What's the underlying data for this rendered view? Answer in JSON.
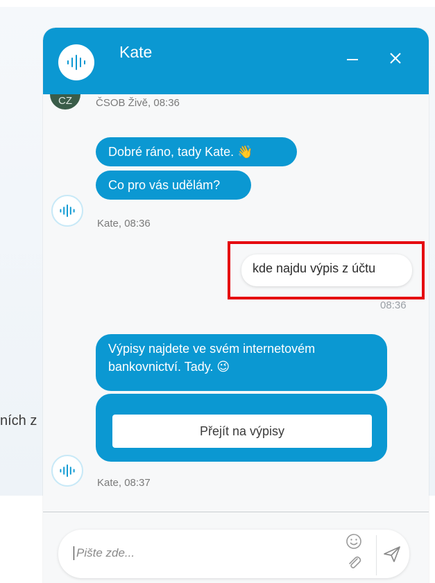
{
  "background": {
    "partial_text": "ních z"
  },
  "header": {
    "title": "Kate",
    "minimize_icon": "minimize-icon",
    "close_icon": "close-icon",
    "brand_color": "#0b98d2"
  },
  "messages": {
    "first_avatar_initials": "CZ",
    "first_meta": "ČSOB Živě, 08:36",
    "bot_msg_1": "Dobré ráno, tady Kate. 👋",
    "bot_msg_2": "Co pro vás udělám?",
    "bot_meta_1": "Kate, 08:36",
    "user_msg": "kde najdu výpis z účtu",
    "user_meta": "08:36",
    "bot_msg_3": "Výpisy najdete ve svém internetovém bankovnictví. Tady. 😉",
    "card_button": "Přejít na výpisy",
    "bot_meta_2": "Kate, 08:37"
  },
  "composer": {
    "placeholder": "Pište zde...",
    "emoji_icon": "smiley-icon",
    "attach_icon": "paperclip-icon",
    "send_icon": "send-icon"
  }
}
